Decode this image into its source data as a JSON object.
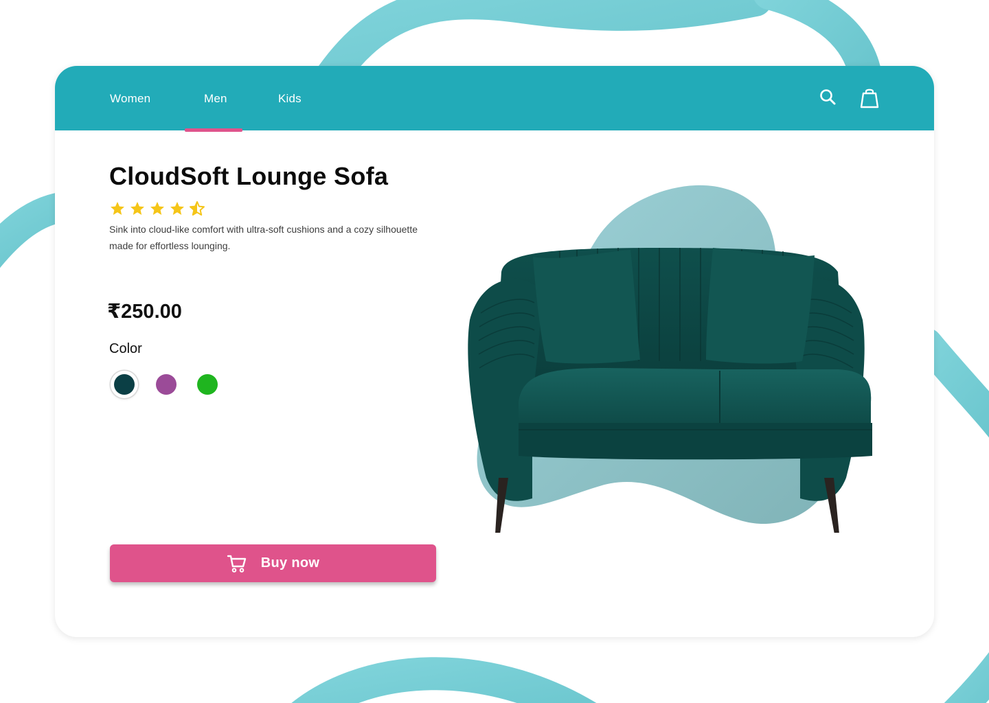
{
  "nav": {
    "items": [
      {
        "label": "Women"
      },
      {
        "label": "Men",
        "active": true
      },
      {
        "label": "Kids"
      }
    ],
    "search_icon": "search-icon",
    "bag_icon": "shopping-bag-icon"
  },
  "product": {
    "title": "CloudSoft Lounge Sofa",
    "rating": 4.5,
    "rating_max": 5,
    "description": "Sink into cloud-like comfort with ultra-soft cushions and a cozy silhouette made for effortless lounging.",
    "price": "₹250.00",
    "color_label": "Color",
    "colors": [
      {
        "hex": "#0b3f45",
        "selected": true
      },
      {
        "hex": "#9b4b98",
        "selected": false
      },
      {
        "hex": "#1fb51f",
        "selected": false
      }
    ],
    "image": "sofa-image"
  },
  "buy": {
    "label": "Buy now",
    "icon": "cart-icon"
  },
  "theme": {
    "accent": "#22abb8",
    "button": "#df538b",
    "star": "#f5c518",
    "blob": "#8fc9cf"
  }
}
